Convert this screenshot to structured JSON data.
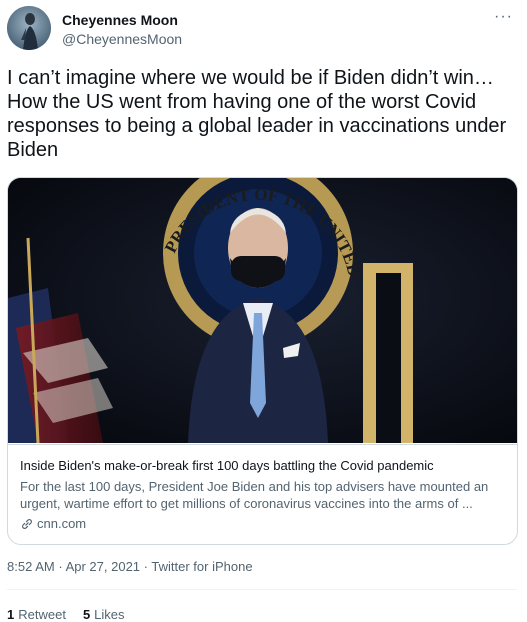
{
  "author": {
    "display_name": "Cheyennes Moon",
    "handle": "@CheyennesMoon"
  },
  "more_icon": "more-horizontal-icon",
  "tweet_text": "I can’t imagine where we would be if Biden didn’t win… How the US went from having one of the worst Covid responses to being a global leader in vaccinations under Biden",
  "card": {
    "image_seal_text": "PRESIDENT OF THE UNITED",
    "title": "Inside Biden's make-or-break first 100 days battling the Covid pandemic",
    "description": "For the last 100 days, President Joe Biden and his top advisers have mounted an urgent, wartime effort to get millions of coronavirus vaccines into the arms of ...",
    "domain": "cnn.com",
    "domain_icon": "link-icon"
  },
  "meta": {
    "time": "8:52 AM",
    "separator": "·",
    "date": "Apr 27, 2021",
    "source": "Twitter for iPhone"
  },
  "stats": {
    "retweets_count": "1",
    "retweets_label": "Retweet",
    "likes_count": "5",
    "likes_label": "Likes"
  }
}
